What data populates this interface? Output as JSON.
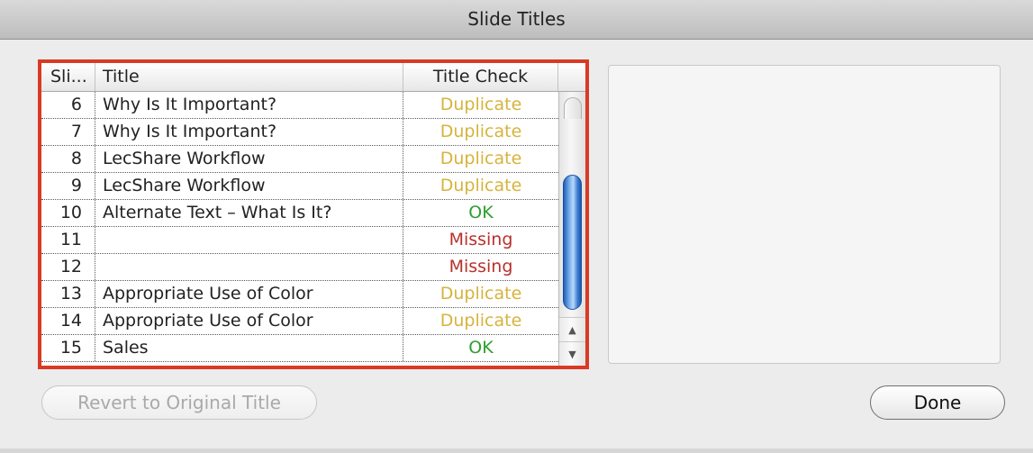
{
  "window": {
    "title": "Slide Titles"
  },
  "table": {
    "columns": [
      "Sli...",
      "Title",
      "Title Check"
    ],
    "rows": [
      {
        "slide": "6",
        "title": "Why Is It Important?",
        "check": "Duplicate",
        "status": "duplicate"
      },
      {
        "slide": "7",
        "title": "Why Is It Important?",
        "check": "Duplicate",
        "status": "duplicate"
      },
      {
        "slide": "8",
        "title": "LecShare Workflow",
        "check": "Duplicate",
        "status": "duplicate"
      },
      {
        "slide": "9",
        "title": "LecShare Workflow",
        "check": "Duplicate",
        "status": "duplicate"
      },
      {
        "slide": "10",
        "title": "Alternate Text – What Is It?",
        "check": "OK",
        "status": "ok"
      },
      {
        "slide": "11",
        "title": "",
        "check": "Missing",
        "status": "missing"
      },
      {
        "slide": "12",
        "title": "",
        "check": "Missing",
        "status": "missing"
      },
      {
        "slide": "13",
        "title": "Appropriate Use of Color",
        "check": "Duplicate",
        "status": "duplicate"
      },
      {
        "slide": "14",
        "title": "Appropriate Use of Color",
        "check": "Duplicate",
        "status": "duplicate"
      },
      {
        "slide": "15",
        "title": "Sales",
        "check": "OK",
        "status": "ok"
      }
    ]
  },
  "status_colors": {
    "duplicate": "#d7b33c",
    "ok": "#2f9e2f",
    "missing": "#b8312a"
  },
  "highlight_color": "#d93a24",
  "buttons": {
    "revert_label": "Revert to Original Title",
    "done_label": "Done"
  },
  "icons": {
    "scroll_up": "arrow-up-icon",
    "scroll_down": "arrow-down-icon"
  }
}
